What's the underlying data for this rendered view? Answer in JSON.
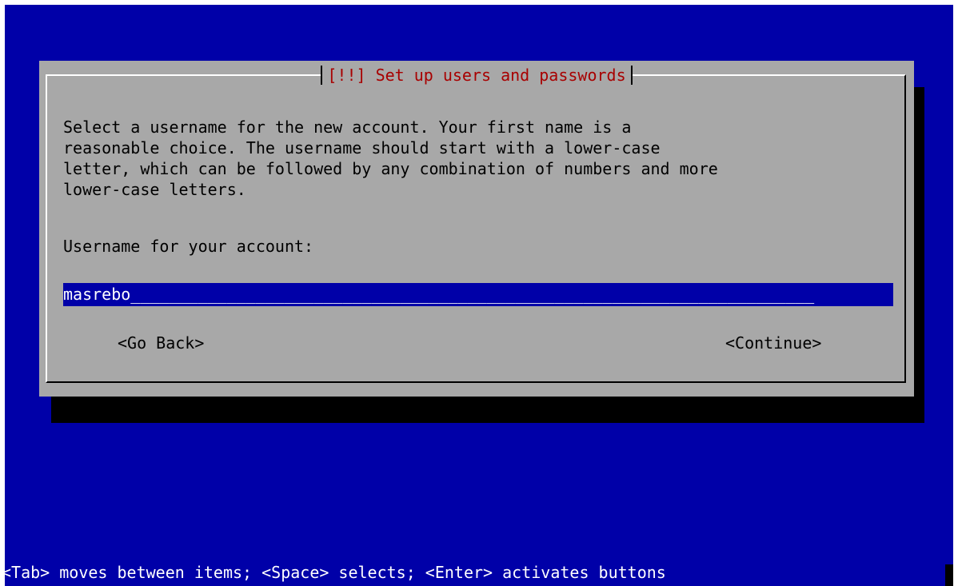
{
  "dialog": {
    "title": "[!!] Set up users and passwords",
    "description": "Select a username for the new account. Your first name is a\nreasonable choice. The username should start with a lower-case\nletter, which can be followed by any combination of numbers and more\nlower-case letters.",
    "field_label": "Username for your account:",
    "username_value": "masrebo",
    "field_fill": "_______________________________________________________________________",
    "buttons": {
      "back": "<Go Back>",
      "continue": "<Continue>"
    }
  },
  "footer": {
    "help": "<Tab> moves between items; <Space> selects; <Enter> activates buttons"
  },
  "colors": {
    "background": "#0000a8",
    "dialog": "#a8a8a8",
    "title": "#a80000",
    "input_bg": "#0000a8",
    "input_text": "#ffffff"
  }
}
